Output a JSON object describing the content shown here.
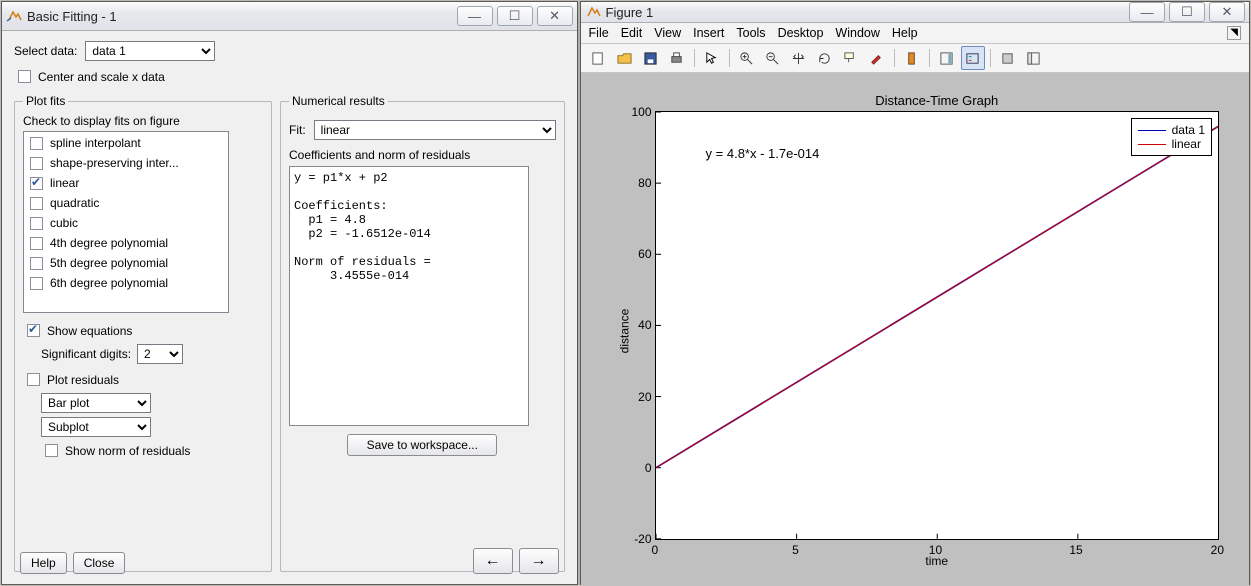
{
  "fitting": {
    "title": "Basic Fitting - 1",
    "selectDataLabel": "Select data:",
    "selectDataValue": "data 1",
    "centerScaleLabel": "Center and scale x data",
    "centerScaleChecked": false,
    "plotFitsLegend": "Plot fits",
    "checkToDisplay": "Check to display fits on figure",
    "fitOptions": [
      {
        "label": "spline interpolant",
        "checked": false
      },
      {
        "label": "shape-preserving inter...",
        "checked": false
      },
      {
        "label": "linear",
        "checked": true
      },
      {
        "label": "quadratic",
        "checked": false
      },
      {
        "label": "cubic",
        "checked": false
      },
      {
        "label": "4th degree polynomial",
        "checked": false
      },
      {
        "label": "5th degree polynomial",
        "checked": false
      },
      {
        "label": "6th degree polynomial",
        "checked": false
      }
    ],
    "showEquationsLabel": "Show equations",
    "showEquationsChecked": true,
    "sigDigitsLabel": "Significant digits:",
    "sigDigitsValue": "2",
    "plotResidualsLabel": "Plot residuals",
    "plotResidualsChecked": false,
    "residualPlotType": "Bar plot",
    "residualLocation": "Subplot",
    "showNormLabel": "Show norm of residuals",
    "showNormChecked": false,
    "numResultsLegend": "Numerical results",
    "fitLabel": "Fit:",
    "fitValue": "linear",
    "coefLabel": "Coefficients and norm of residuals",
    "resultsText": "y = p1*x + p2\n\nCoefficients:\n  p1 = 4.8\n  p2 = -1.6512e-014\n\nNorm of residuals = \n     3.4555e-014",
    "saveWorkspace": "Save to workspace...",
    "helpBtn": "Help",
    "closeBtn": "Close"
  },
  "figure": {
    "title": "Figure 1",
    "menus": [
      "File",
      "Edit",
      "View",
      "Insert",
      "Tools",
      "Desktop",
      "Window",
      "Help"
    ],
    "chart_title": "Distance-Time Graph",
    "xlabel": "time",
    "ylabel": "distance",
    "equation": "y = 4.8*x - 1.7e-014",
    "legend": [
      {
        "name": "data 1",
        "color": "#0000bb"
      },
      {
        "name": "linear",
        "color": "#d00000"
      }
    ]
  },
  "chart_data": {
    "type": "line",
    "title": "Distance-Time Graph",
    "xlabel": "time",
    "ylabel": "distance",
    "xlim": [
      0,
      20
    ],
    "ylim": [
      -20,
      100
    ],
    "xticks": [
      0,
      5,
      10,
      15,
      20
    ],
    "yticks": [
      -20,
      0,
      20,
      40,
      60,
      80,
      100
    ],
    "equation_annotation": "y = 4.8*x - 1.7e-014",
    "series": [
      {
        "name": "data 1",
        "color": "#0000bb",
        "x": [
          0,
          5,
          10,
          15,
          20
        ],
        "y": [
          0,
          24,
          48,
          72,
          96
        ]
      },
      {
        "name": "linear",
        "color": "#d00000",
        "x": [
          0,
          20
        ],
        "y": [
          0,
          96
        ]
      }
    ]
  }
}
